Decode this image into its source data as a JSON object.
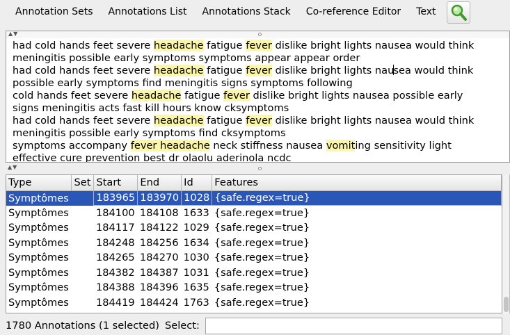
{
  "toolbar": {
    "annotation_sets": "Annotation Sets",
    "annotations_list": "Annotations List",
    "annotations_stack": "Annotations Stack",
    "coreference_editor": "Co-reference Editor",
    "text": "Text",
    "search_icon": "magnifier-search-icon"
  },
  "text_lines": [
    [
      {
        "t": "had cold hands feet severe "
      },
      {
        "t": "headache",
        "h": true
      },
      {
        "t": " fatigue "
      },
      {
        "t": "fever",
        "h": true
      },
      {
        "t": " dislike bright lights nausea would think"
      }
    ],
    [
      {
        "t": "meningitis possible early symptoms symptoms appear appear order"
      }
    ],
    [
      {
        "t": "had cold hands feet severe "
      },
      {
        "t": "headache",
        "h": true
      },
      {
        "t": " fatigue "
      },
      {
        "t": "fever",
        "h": true
      },
      {
        "t": " dislike bright lights nau"
      },
      {
        "caret": true
      },
      {
        "t": "sea would think"
      }
    ],
    [
      {
        "t": "possible early symptoms find meningitis signs symptoms following"
      }
    ],
    [
      {
        "t": "cold hands feet severe "
      },
      {
        "t": "headache",
        "h": true
      },
      {
        "t": " fatigue "
      },
      {
        "t": "fever",
        "h": true
      },
      {
        "t": " dislike bright lights nausea possible early"
      }
    ],
    [
      {
        "t": "signs meningitis acts fast kill hours know cksymptoms"
      }
    ],
    [
      {
        "t": "had cold hands feet severe "
      },
      {
        "t": "headache",
        "h": true
      },
      {
        "t": " fatigue "
      },
      {
        "t": "fever",
        "h": true
      },
      {
        "t": " dislike bright lights nausea would think"
      }
    ],
    [
      {
        "t": "meningitis possible early symptoms find cksymptoms"
      }
    ],
    [
      {
        "t": "symptoms accompany "
      },
      {
        "t": "fever headache",
        "h": true
      },
      {
        "t": " neck stiffness nausea "
      },
      {
        "t": "vomit",
        "h": true
      },
      {
        "t": "ing sensitivity light"
      }
    ],
    [
      {
        "t": "effective cure prevention best dr olaolu aderinola ncdc"
      }
    ]
  ],
  "table": {
    "headers": {
      "type": "Type",
      "set": "Set",
      "start": "Start",
      "end": "End",
      "id": "Id",
      "features": "Features"
    },
    "rows": [
      {
        "type": "Symptômes",
        "set": "",
        "start": "183965",
        "end": "183970",
        "id": "1028",
        "features": "{safe.regex=true}",
        "selected": true
      },
      {
        "type": "Symptômes",
        "set": "",
        "start": "184100",
        "end": "184108",
        "id": "1633",
        "features": "{safe.regex=true}"
      },
      {
        "type": "Symptômes",
        "set": "",
        "start": "184117",
        "end": "184122",
        "id": "1029",
        "features": "{safe.regex=true}"
      },
      {
        "type": "Symptômes",
        "set": "",
        "start": "184248",
        "end": "184256",
        "id": "1634",
        "features": "{safe.regex=true}"
      },
      {
        "type": "Symptômes",
        "set": "",
        "start": "184265",
        "end": "184270",
        "id": "1030",
        "features": "{safe.regex=true}"
      },
      {
        "type": "Symptômes",
        "set": "",
        "start": "184382",
        "end": "184387",
        "id": "1031",
        "features": "{safe.regex=true}"
      },
      {
        "type": "Symptômes",
        "set": "",
        "start": "184388",
        "end": "184396",
        "id": "1635",
        "features": "{safe.regex=true}"
      },
      {
        "type": "Symptômes",
        "set": "",
        "start": "184419",
        "end": "184424",
        "id": "1763",
        "features": "{safe.regex=true}"
      }
    ]
  },
  "status": {
    "summary": "1780 Annotations (1 selected)",
    "select_label": "Select:",
    "select_value": ""
  },
  "colors": {
    "highlight": "#fcf7a8",
    "selection": "#2a56b8"
  }
}
